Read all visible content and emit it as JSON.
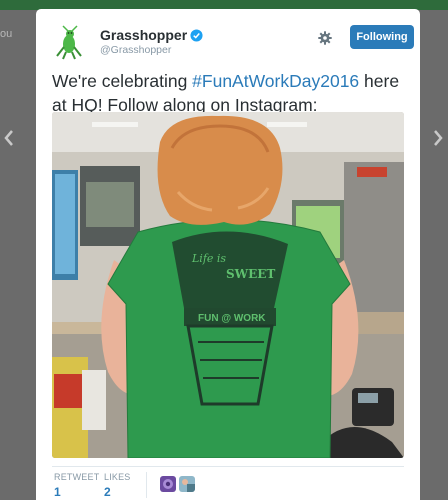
{
  "backdrop": {
    "left_text": "ou"
  },
  "tweet": {
    "display_name": "Grasshopper",
    "handle": "@Grasshopper",
    "follow_button_label": "Following",
    "text_part1": "We're celebrating ",
    "hashtag": "#FunAtWorkDay2016",
    "text_part2": " here at HQ! Follow along on Instagram: getgrasshopper.",
    "stats": {
      "retweet_label": "RETWEET",
      "retweet_count": "1",
      "likes_label": "LIKES",
      "likes_count": "2"
    }
  },
  "icons": {
    "prev": "chevron-left-icon",
    "next": "chevron-right-icon",
    "verified": "verified-badge-icon",
    "settings": "gear-icon"
  },
  "colors": {
    "accent": "#2b7bb9",
    "follow_button": "#2b7bb9",
    "text": "#292f33",
    "muted": "#8899a6"
  }
}
